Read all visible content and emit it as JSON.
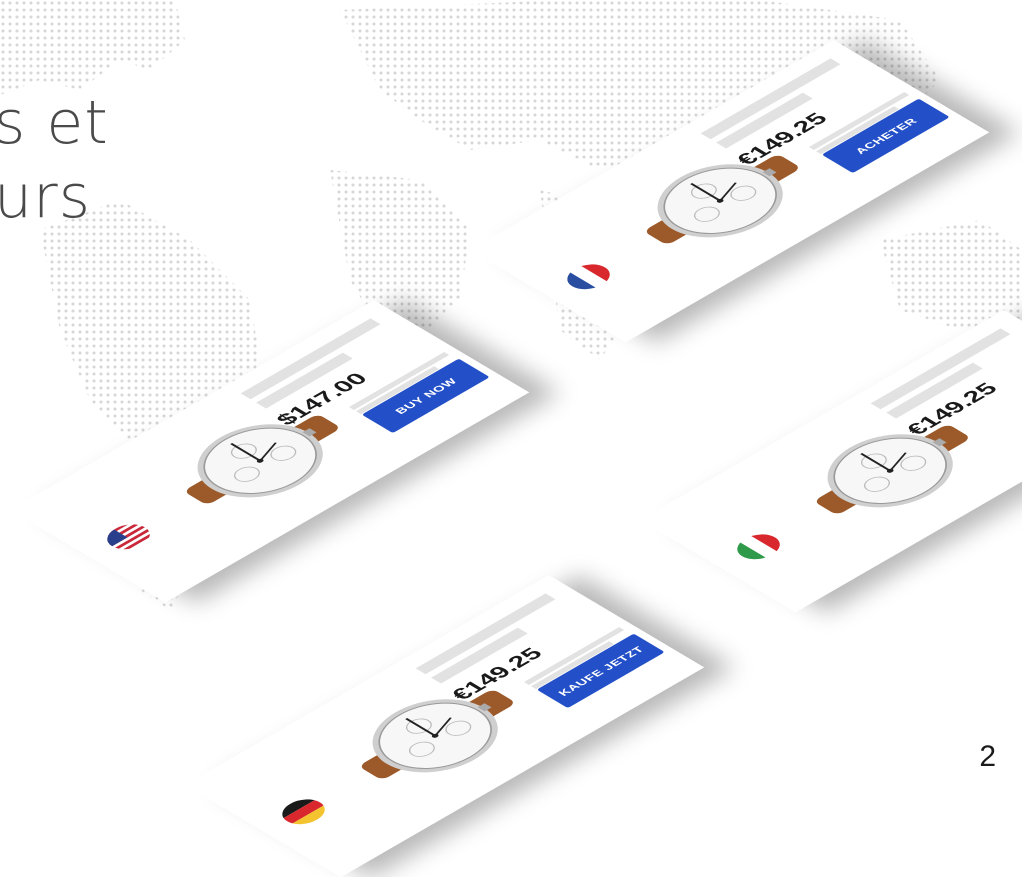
{
  "headline": {
    "line1": "s et",
    "line2": "urs"
  },
  "cards": [
    {
      "flag": "france-flag",
      "price": "€149.25",
      "button": "ACHETER"
    },
    {
      "flag": "usa-flag",
      "price": "$147.00",
      "button": "BUY NOW"
    },
    {
      "flag": "italy-flag",
      "price": "€149.25",
      "button": ""
    },
    {
      "flag": "germany-flag",
      "price": "€149.25",
      "button": "KAUFE JETZT"
    }
  ],
  "page_number": "2",
  "colors": {
    "button_blue": "#2350c8",
    "placeholder_gray": "#e2e2e2",
    "map_dots": "#d6d6d6",
    "strap_brown": "#9c5a2a"
  }
}
